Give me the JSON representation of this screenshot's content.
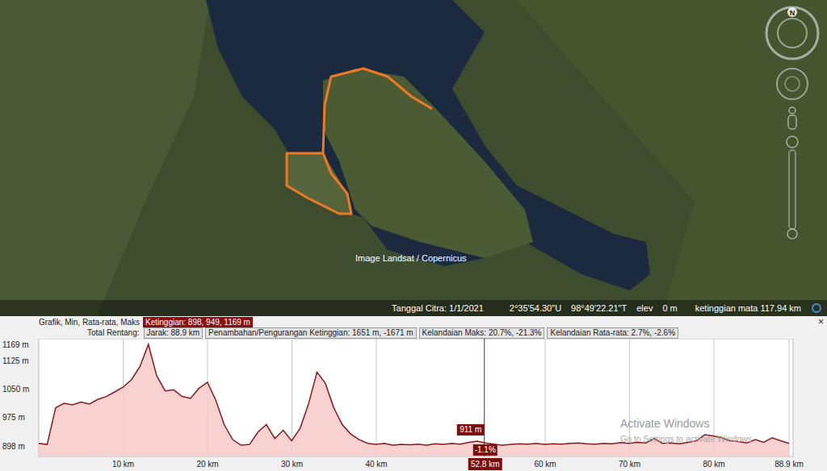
{
  "map": {
    "attribution": "Image Landsat / Copernicus"
  },
  "status_bar": {
    "date": "Tanggal Citra: 1/1/2021",
    "latitude": "2°35'54.30\"U",
    "longitude": "98°49'22.21\"T",
    "elev_label": "elev",
    "elev_value": "0 m",
    "eye_altitude": "ketinggian mata 117.94 km"
  },
  "compass": {
    "north": "N"
  },
  "profile": {
    "header_label": "Grafik, Min, Rata-rata, Maks",
    "selected_stat": "Ketinggian: 898, 949, 1169 m",
    "close": "×",
    "summary_label": "Total Rentang:",
    "summary": [
      "Jarak: 88.9 km",
      "Penambahan/Pengurangan Ketinggian: 1651 m, -1671 m",
      "Kelandaian Maks: 20.7%, -21.3%",
      "Kelandaian Rata-rata: 2.7%, -2.6%"
    ],
    "y_ticks": [
      "1169 m",
      "1125 m",
      "1050 m",
      "975 m",
      "898 m"
    ],
    "x_ticks": [
      "10 km",
      "20 km",
      "30 km",
      "40 km",
      "60 km",
      "70 km",
      "80 km",
      "88.9 km"
    ],
    "series": {
      "name": "elevation",
      "values": [
        905,
        902,
        1000,
        1012,
        1008,
        1015,
        1010,
        1022,
        1030,
        1042,
        1055,
        1075,
        1110,
        1169,
        1085,
        1045,
        1048,
        1030,
        1025,
        1052,
        1068,
        1020,
        955,
        915,
        900,
        902,
        935,
        955,
        918,
        940,
        912,
        945,
        1010,
        1095,
        1065,
        1000,
        955,
        930,
        915,
        905,
        902,
        905,
        900,
        902,
        901,
        903,
        900,
        904,
        902,
        905,
        903,
        908,
        911,
        906,
        903,
        900,
        902,
        904,
        903,
        905,
        902,
        904,
        903,
        905,
        906,
        904,
        903,
        905,
        904,
        907,
        905,
        908,
        906,
        918,
        905,
        906,
        904,
        908,
        912,
        928,
        925,
        920,
        912,
        910,
        906,
        915,
        908,
        920,
        912,
        905
      ]
    },
    "cursor": {
      "elevation": "911 m",
      "slope": "-1.1%",
      "distance": "52.8 km"
    }
  },
  "watermark": {
    "title": "Activate Windows",
    "subtitle": "Go to Settings to activate Windows."
  }
}
